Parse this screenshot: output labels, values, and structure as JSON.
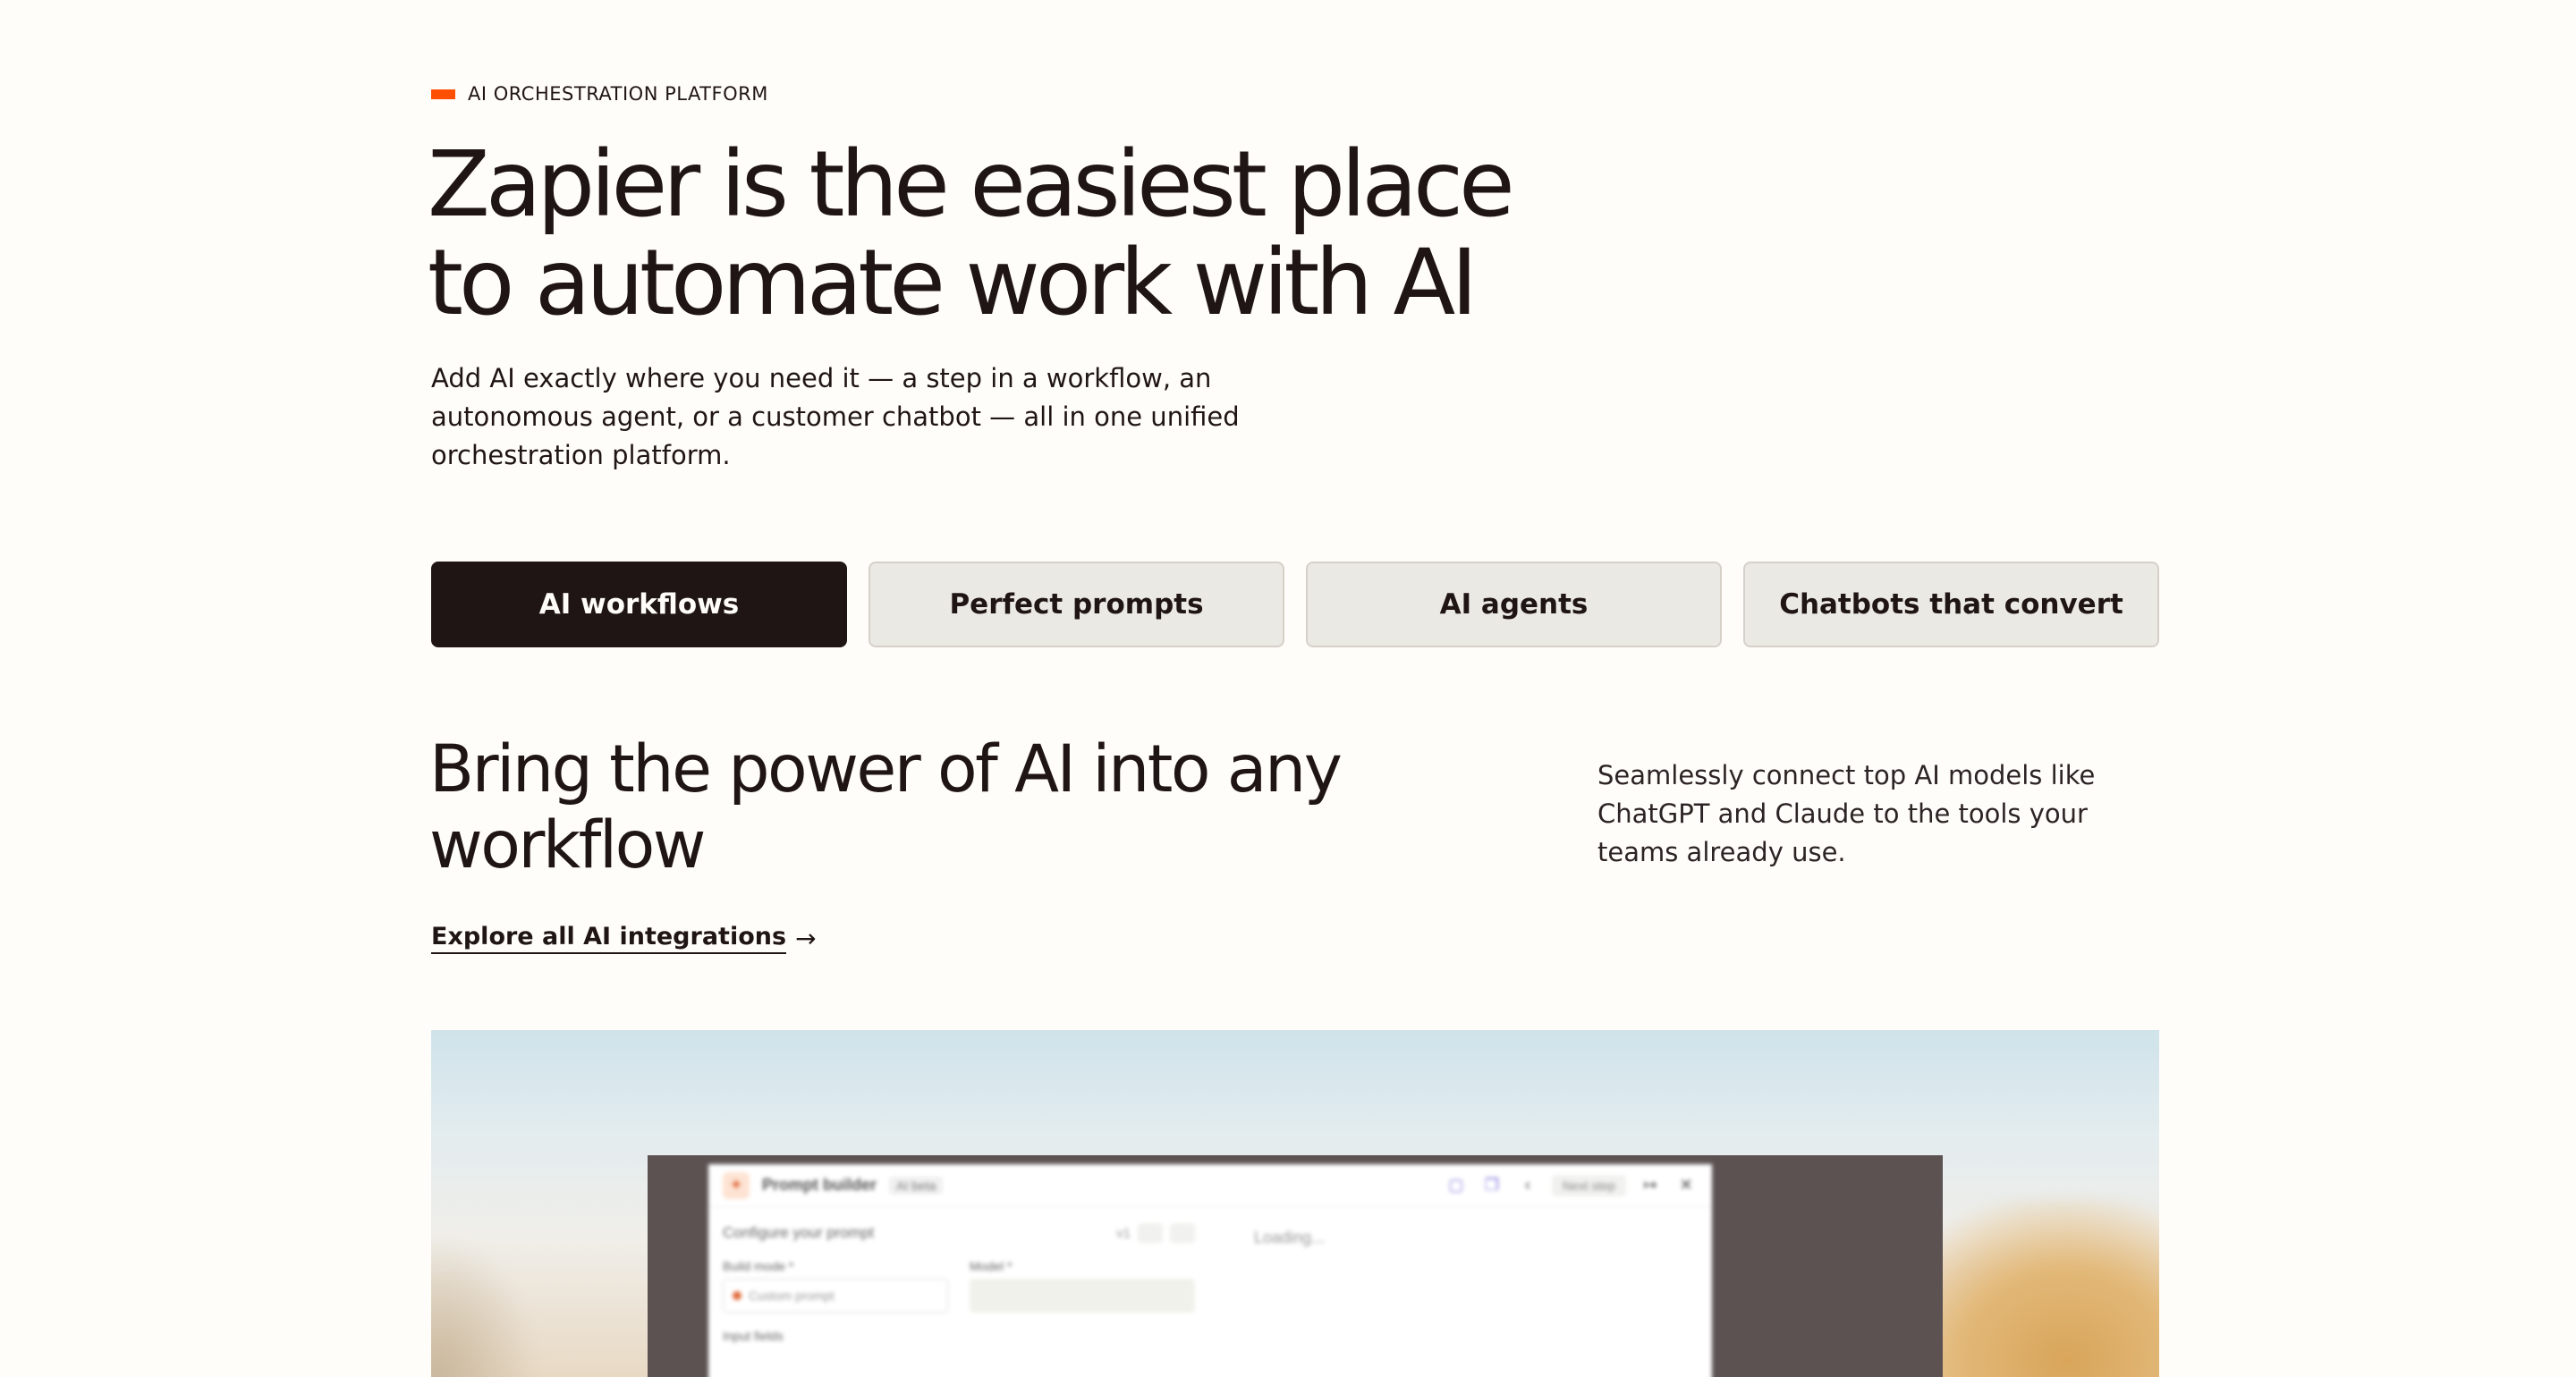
{
  "hero": {
    "eyebrow": "AI ORCHESTRATION PLATFORM",
    "title_line1": "Zapier is the easiest place",
    "title_line2": "to automate work with AI",
    "subtitle": "Add AI exactly where you need it — a step in a workflow, an autonomous agent, or a customer chatbot — all in one unified orchestration platform.",
    "accent_color": "#ff4f00"
  },
  "tabs": [
    {
      "label": "AI workflows",
      "active": true
    },
    {
      "label": "Perfect prompts",
      "active": false
    },
    {
      "label": "AI agents",
      "active": false
    },
    {
      "label": "Chatbots that convert",
      "active": false
    }
  ],
  "section": {
    "title": "Bring the power of AI into any workflow",
    "description": "Seamlessly connect top AI models like ChatGPT and Claude to the tools your teams already use.",
    "link_label": "Explore all AI integrations",
    "link_arrow": "→"
  },
  "preview": {
    "app_title": "Prompt builder",
    "app_badge": "AI beta",
    "next_step": "Next step",
    "configure_label": "Configure your prompt",
    "version_label": "v1",
    "field1_label": "Build mode *",
    "field1_value": "Custom prompt",
    "field2_label": "Model *",
    "field3_label": "Input fields",
    "loading": "Loading..."
  }
}
